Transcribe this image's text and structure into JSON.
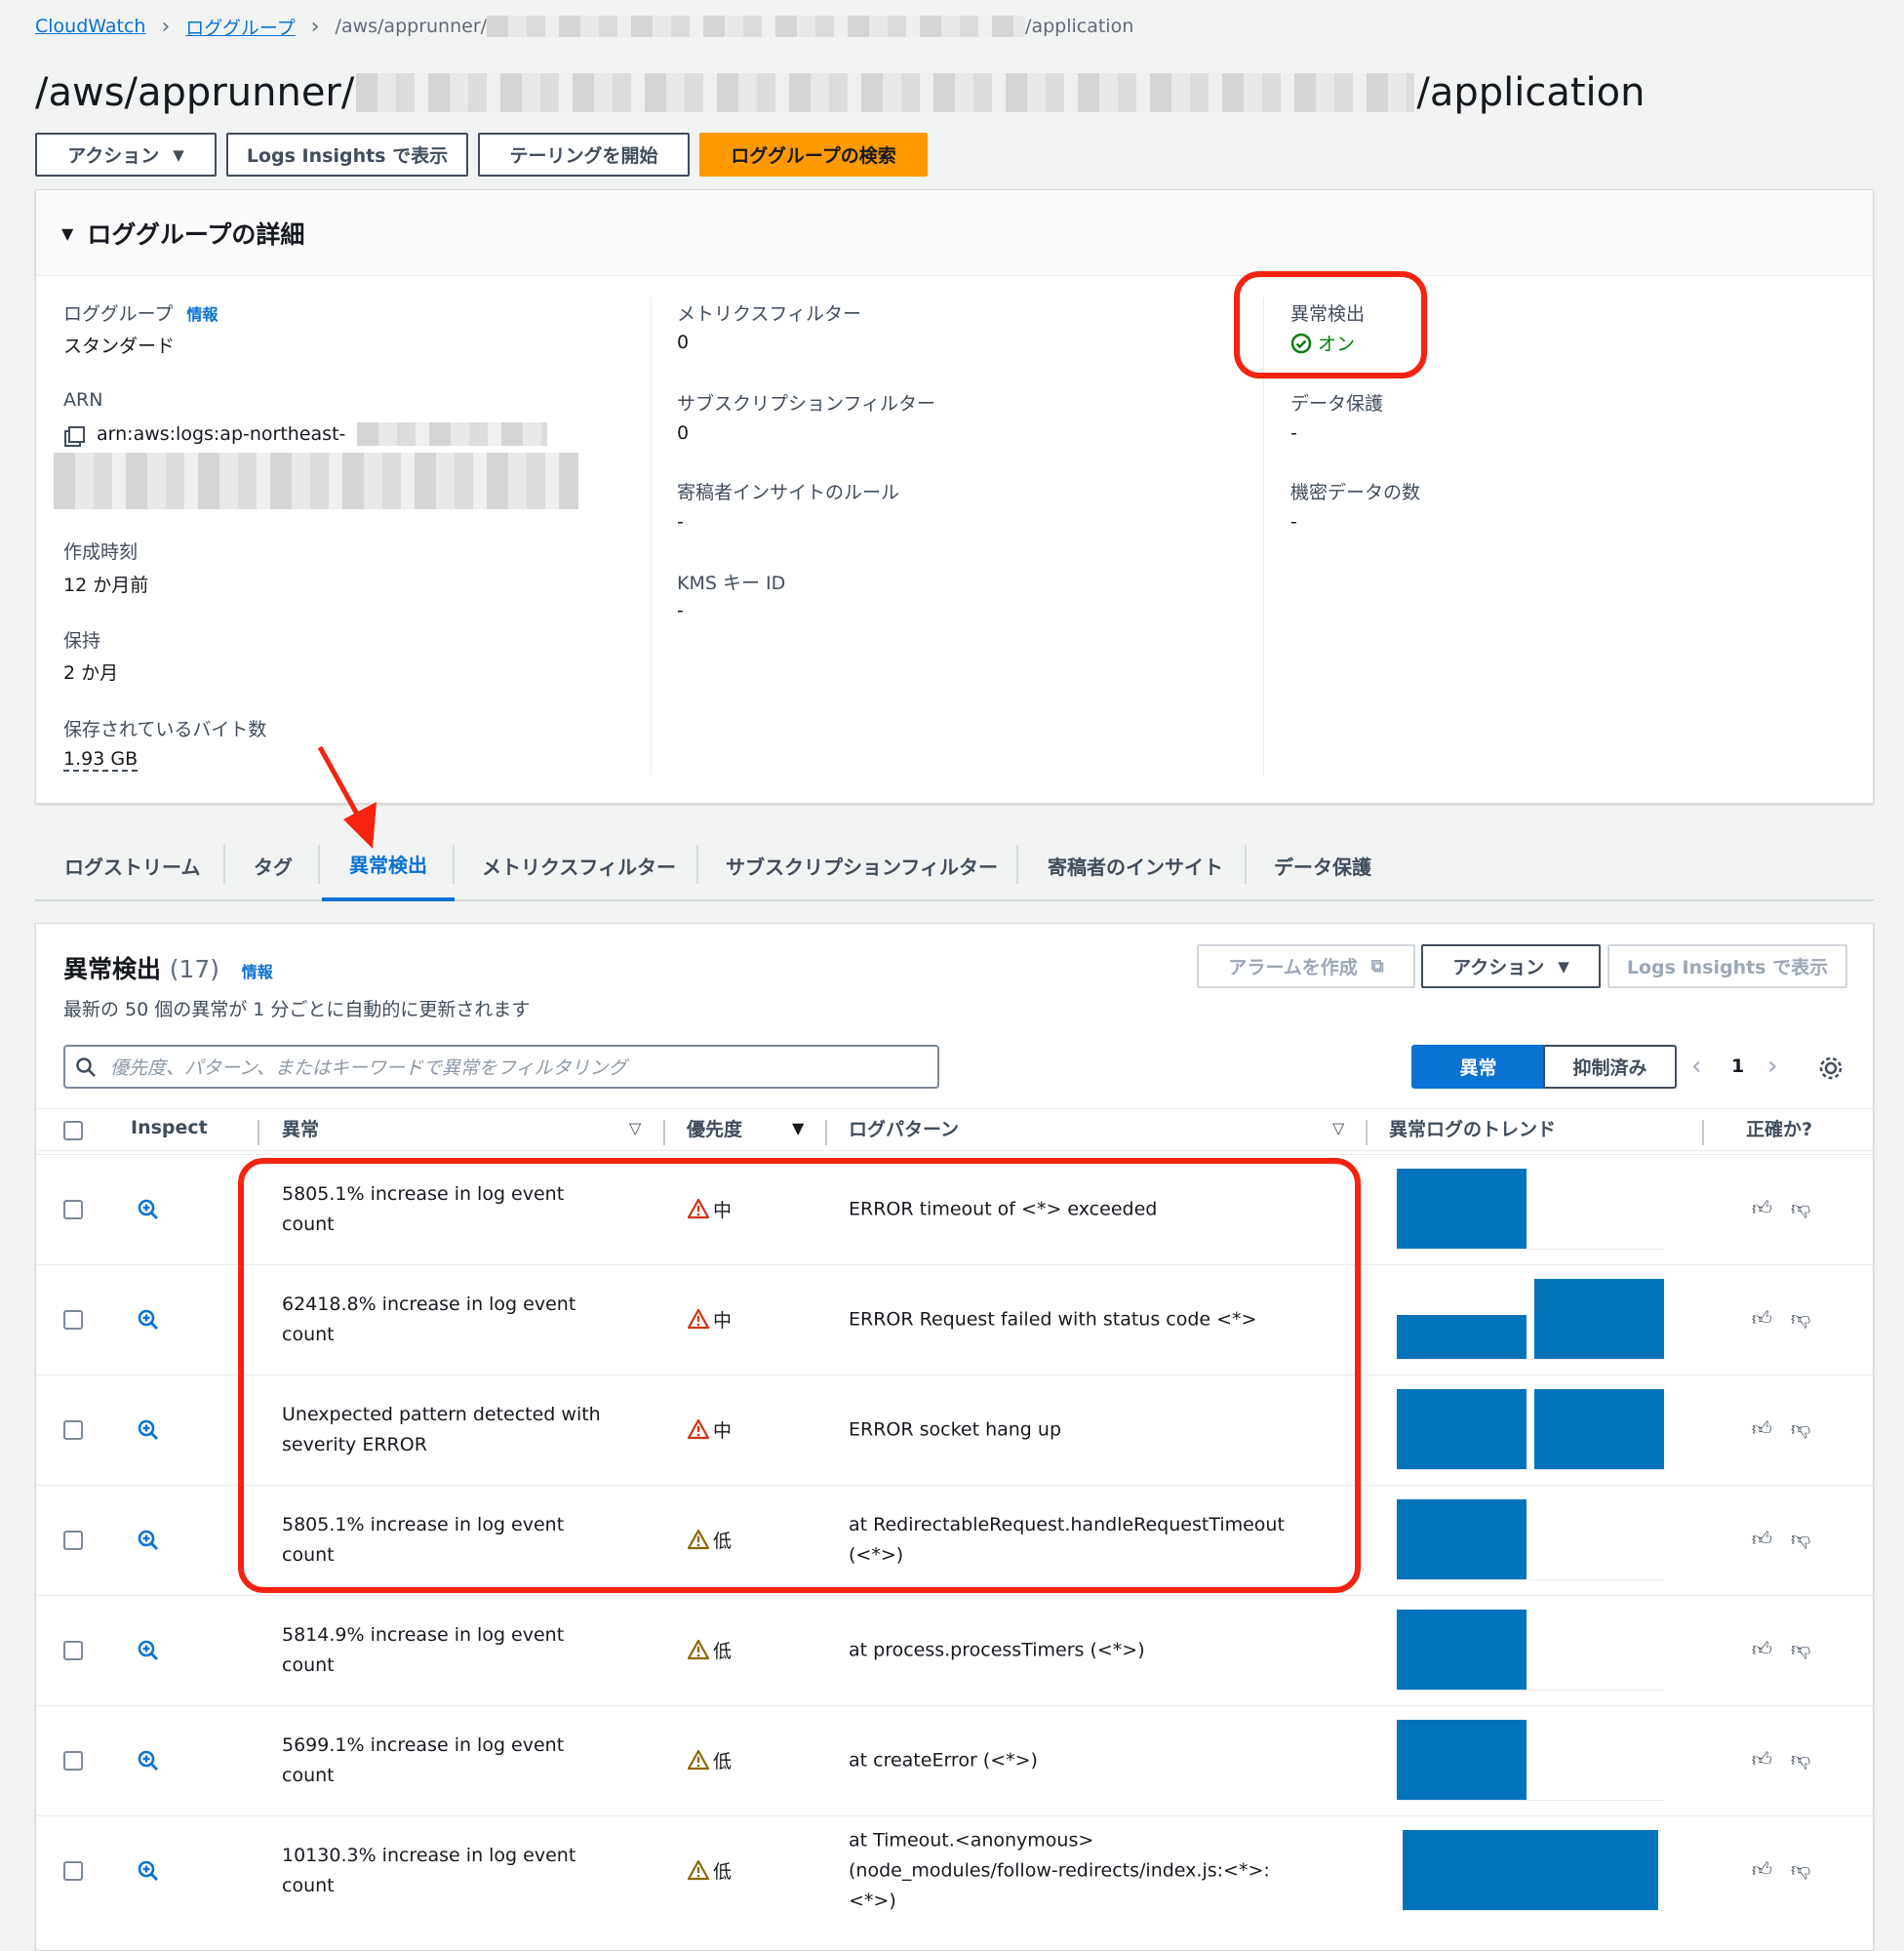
{
  "breadcrumb": {
    "root": "CloudWatch",
    "group": "ロググループ",
    "current_prefix": "/aws/apprunner/",
    "current_suffix": "/application"
  },
  "page_title": {
    "prefix": "/aws/apprunner/",
    "suffix": "/application"
  },
  "toolbar": {
    "actions": "アクション",
    "logs_insights": "Logs Insights で表示",
    "tail": "テーリングを開始",
    "search": "ロググループの検索"
  },
  "details": {
    "title": "ロググループの詳細",
    "log_class_label": "ロググループ",
    "log_class_info": "情報",
    "log_class_value": "スタンダード",
    "arn_label": "ARN",
    "arn_value": "arn:aws:logs:ap-northeast-",
    "created_label": "作成時刻",
    "created_value": "12 か月前",
    "retention_label": "保持",
    "retention_value": "2 か月",
    "bytes_label": "保存されているバイト数",
    "bytes_value": "1.93 GB",
    "metric_filters_label": "メトリクスフィルター",
    "metric_filters_value": "0",
    "subscription_label": "サブスクリプションフィルター",
    "subscription_value": "0",
    "contributor_label": "寄稿者インサイトのルール",
    "contributor_value": "-",
    "kms_label": "KMS キー ID",
    "kms_value": "-",
    "anomaly_label": "異常検出",
    "anomaly_value": "オン",
    "data_protection_label": "データ保護",
    "data_protection_value": "-",
    "sensitive_label": "機密データの数",
    "sensitive_value": "-"
  },
  "tabs": [
    "ログストリーム",
    "タグ",
    "異常検出",
    "メトリクスフィルター",
    "サブスクリプションフィルター",
    "寄稿者のインサイト",
    "データ保護"
  ],
  "anomaly_section": {
    "title": "異常検出",
    "count": "(17)",
    "info": "情報",
    "subtitle": "最新の 50 個の異常が 1 分ごとに自動的に更新されます",
    "create_alarm": "アラームを作成",
    "actions": "アクション",
    "logs_insights": "Logs Insights で表示",
    "search_placeholder": "優先度、パターン、またはキーワードで異常をフィルタリング",
    "seg_anomalies": "異常",
    "seg_suppressed": "抑制済み",
    "page": "1"
  },
  "columns": {
    "inspect": "Inspect",
    "anomaly": "異常",
    "priority": "優先度",
    "pattern": "ログパターン",
    "trend": "異常ログのトレンド",
    "accurate": "正確か?"
  },
  "rows": [
    {
      "anomaly": "5805.1% increase in log event count",
      "priority": "中",
      "pattern": "ERROR timeout of <*> exceeded",
      "trend": [
        1.0,
        0.0
      ]
    },
    {
      "anomaly": "62418.8% increase in log event count",
      "priority": "中",
      "pattern": "ERROR Request failed with status code <*>",
      "trend": [
        0.55,
        1.0
      ]
    },
    {
      "anomaly": "Unexpected pattern detected with severity ERROR",
      "priority": "中",
      "pattern": "ERROR socket hang up",
      "trend": [
        1.0,
        1.0
      ]
    },
    {
      "anomaly": "5805.1% increase in log event count",
      "priority": "低",
      "pattern": "at RedirectableRequest.handleRequestTimeout (<*>)",
      "trend": [
        1.0,
        0.0
      ]
    },
    {
      "anomaly": "5814.9% increase in log event count",
      "priority": "低",
      "pattern": "at process.processTimers (<*>)",
      "trend": [
        1.0,
        0.0
      ]
    },
    {
      "anomaly": "5699.1% increase in log event count",
      "priority": "低",
      "pattern": "at createError (<*>)",
      "trend": [
        1.0,
        0.0
      ]
    },
    {
      "anomaly": "10130.3% increase in log event count",
      "priority": "低",
      "pattern": "at Timeout.<anonymous> (node_modules/follow-redirects/index.js:<*>:<*>)",
      "trend": [
        1.0
      ]
    }
  ],
  "colors": {
    "accent": "#0972d3",
    "primary_button": "#ff9900",
    "highlight": "#f5230f",
    "trend_bar": "#0073bb",
    "warn_medium": "#d13212",
    "warn_low": "#8d6605"
  }
}
